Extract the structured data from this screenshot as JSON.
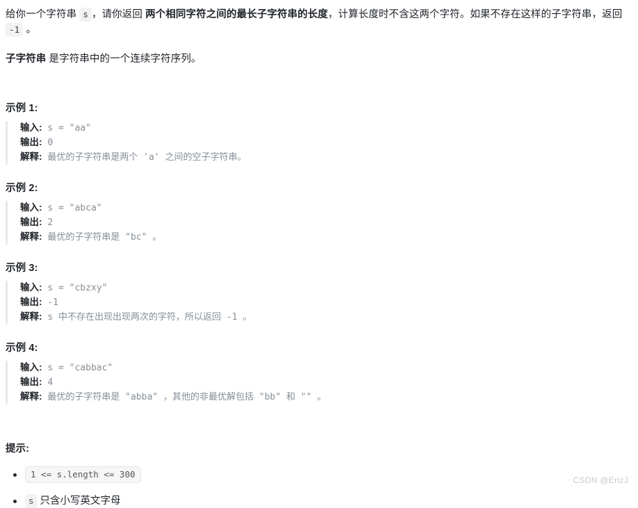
{
  "problem": {
    "intro": {
      "seg1": "给你一个字符串 ",
      "code_s": "s",
      "seg2": "，请你返回 ",
      "bold_phrase": "两个相同字符之间的最长子字符串的长度",
      "seg3": "，计算长度时不含这两个字符。如果不存在这样的子字符串，返回 ",
      "code_neg1": "-1",
      "seg4": " 。"
    },
    "definition": {
      "bold_term": "子字符串",
      "text": " 是字符串中的一个连续字符序列。"
    }
  },
  "examples": [
    {
      "title": "示例 1:",
      "input_label": "输入:",
      "input_value": "s = \"aa\"",
      "output_label": "输出:",
      "output_value": "0",
      "explain_label": "解释:",
      "explain_value": "最优的子字符串是两个 'a' 之间的空子字符串。"
    },
    {
      "title": "示例 2:",
      "input_label": "输入:",
      "input_value": "s = \"abca\"",
      "output_label": "输出:",
      "output_value": "2",
      "explain_label": "解释:",
      "explain_value": "最优的子字符串是 \"bc\" 。"
    },
    {
      "title": "示例 3:",
      "input_label": "输入:",
      "input_value": "s = \"cbzxy\"",
      "output_label": "输出:",
      "output_value": "-1",
      "explain_label": "解释:",
      "explain_value": "s 中不存在出现出现两次的字符，所以返回 -1 。"
    },
    {
      "title": "示例 4:",
      "input_label": "输入:",
      "input_value": "s = \"cabbac\"",
      "output_label": "输出:",
      "output_value": "4",
      "explain_label": "解释:",
      "explain_value": "最优的子字符串是 \"abba\" ，其他的非最优解包括 \"bb\" 和 \"\" 。"
    }
  ],
  "hints": {
    "title": "提示:",
    "items": [
      {
        "code": "1 <= s.length <= 300",
        "text": ""
      },
      {
        "code": "s",
        "text": "只含小写英文字母"
      }
    ]
  },
  "watermark": "CSDN @ErizJ",
  "colors": {
    "text": "#1f2328",
    "muted": "#868e96",
    "code_bg": "#f2f2f3",
    "rule": "#e8e8ea",
    "watermark": "#c9c9cd"
  }
}
